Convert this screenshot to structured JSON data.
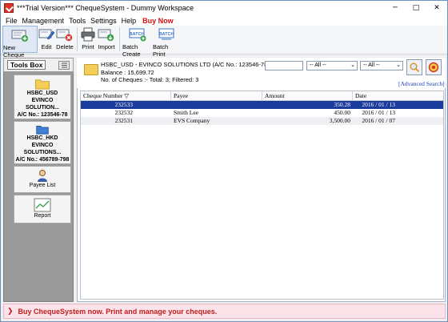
{
  "window": {
    "title": "***Trial Version*** ChequeSystem - Dummy Workspace",
    "controls": {
      "minimize": "─",
      "maximize": "□",
      "close": "✕"
    }
  },
  "menubar": {
    "items": [
      {
        "label": "File"
      },
      {
        "label": "Management"
      },
      {
        "label": "Tools"
      },
      {
        "label": "Settings"
      },
      {
        "label": "Help"
      },
      {
        "label": "Buy Now"
      }
    ]
  },
  "toolbar": {
    "buttons": [
      {
        "label": "New Cheque",
        "icon": "new-cheque-icon"
      },
      {
        "label": "Edit",
        "icon": "edit-icon"
      },
      {
        "label": "Delete",
        "icon": "delete-icon"
      },
      {
        "label": "Print",
        "icon": "printer-icon"
      },
      {
        "label": "Import",
        "icon": "import-icon"
      },
      {
        "label": "Batch Create",
        "icon": "batch-create-icon",
        "badge": "BATCH"
      },
      {
        "label": "Batch Print",
        "icon": "batch-print-icon",
        "badge": "BATCH"
      }
    ]
  },
  "sidebar": {
    "header": "Tools Box",
    "accounts": [
      {
        "line1": "HSBC_USD",
        "line2": "EVINCO SOLUTION...",
        "line3": "A/C No.: 123546-78"
      },
      {
        "line1": "HSBC_HKD",
        "line2": "EVINCO SOLUTIONS...",
        "line3": "A/C No.: 456789-798"
      }
    ],
    "tools": [
      {
        "label": "Payee List"
      },
      {
        "label": "Report"
      }
    ]
  },
  "account": {
    "title": "HSBC_USD - EVINCO SOLUTIONS LTD (A/C No.: 123546-78)",
    "balance": "Balance : 15,699.72",
    "count": "No. of Cheques :- Total: 3; Filtered: 3"
  },
  "filters": {
    "search_value": "",
    "select1": "-- All --",
    "select2": "-- All --",
    "advanced_search": "[Advanced Search]"
  },
  "table": {
    "headers": [
      "Cheque Number ▽",
      "Payee",
      "Amount",
      "Date"
    ],
    "rows": [
      {
        "number": "232533",
        "payee": "",
        "amount": "350.28",
        "date": "2016 / 01 / 13",
        "selected": true
      },
      {
        "number": "232532",
        "payee": "Smith Lee",
        "amount": "450.00",
        "date": "2016 / 01 / 13",
        "selected": false
      },
      {
        "number": "232531",
        "payee": "EVS Company",
        "amount": "3,500.00",
        "date": "2016 / 01 / 07",
        "selected": false
      }
    ]
  },
  "statusbar": {
    "text": "Buy ChequeSystem now. Print and manage your cheques."
  },
  "colors": {
    "selection": "#1a3a9c",
    "status_text": "#c21c1c",
    "buy_now": "#d01010",
    "link": "#1c3fbf"
  }
}
